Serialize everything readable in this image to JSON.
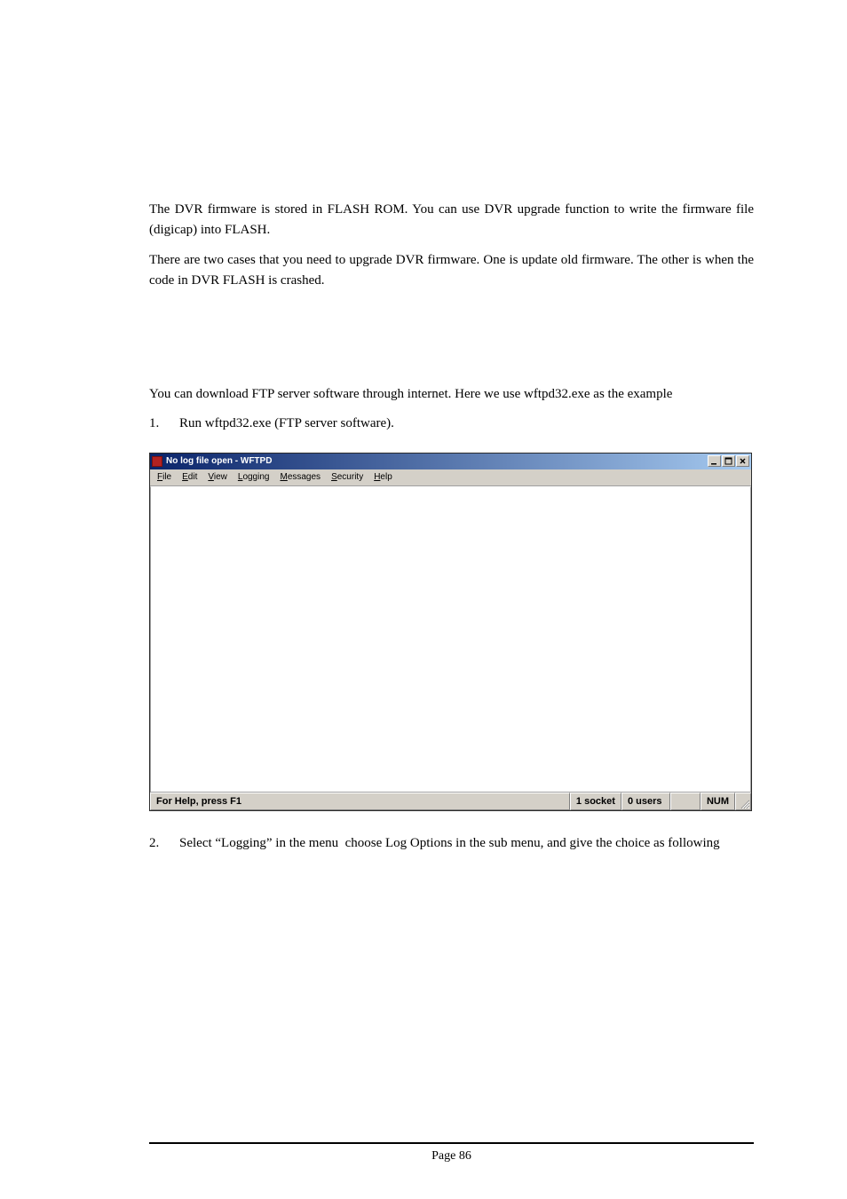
{
  "paragraphs": {
    "p1": "The DVR firmware is stored in FLASH ROM. You can use DVR upgrade function to write the firmware file (digicap) into FLASH.",
    "p2": "There are two cases that you need to upgrade DVR firmware. One is update old firmware. The other is when the code in DVR FLASH is crashed.",
    "p3": "You can download FTP server software through internet. Here we use wftpd32.exe as the example"
  },
  "list": {
    "item1_num": "1.",
    "item1_text": "Run wftpd32.exe (FTP server software).",
    "item2_num": "2.",
    "item2_text": "Select “Logging” in the menu  choose Log Options in the sub menu, and give the choice as following"
  },
  "window": {
    "title": "No log file open - WFTPD",
    "menu": {
      "file": "File",
      "edit": "Edit",
      "view": "View",
      "logging": "Logging",
      "messages": "Messages",
      "security": "Security",
      "help": "Help"
    },
    "status": {
      "help": "For Help, press F1",
      "sockets": "1 socket",
      "users": "0 users",
      "empty": "",
      "num": "NUM"
    }
  },
  "footer": {
    "label": "Page 86"
  }
}
